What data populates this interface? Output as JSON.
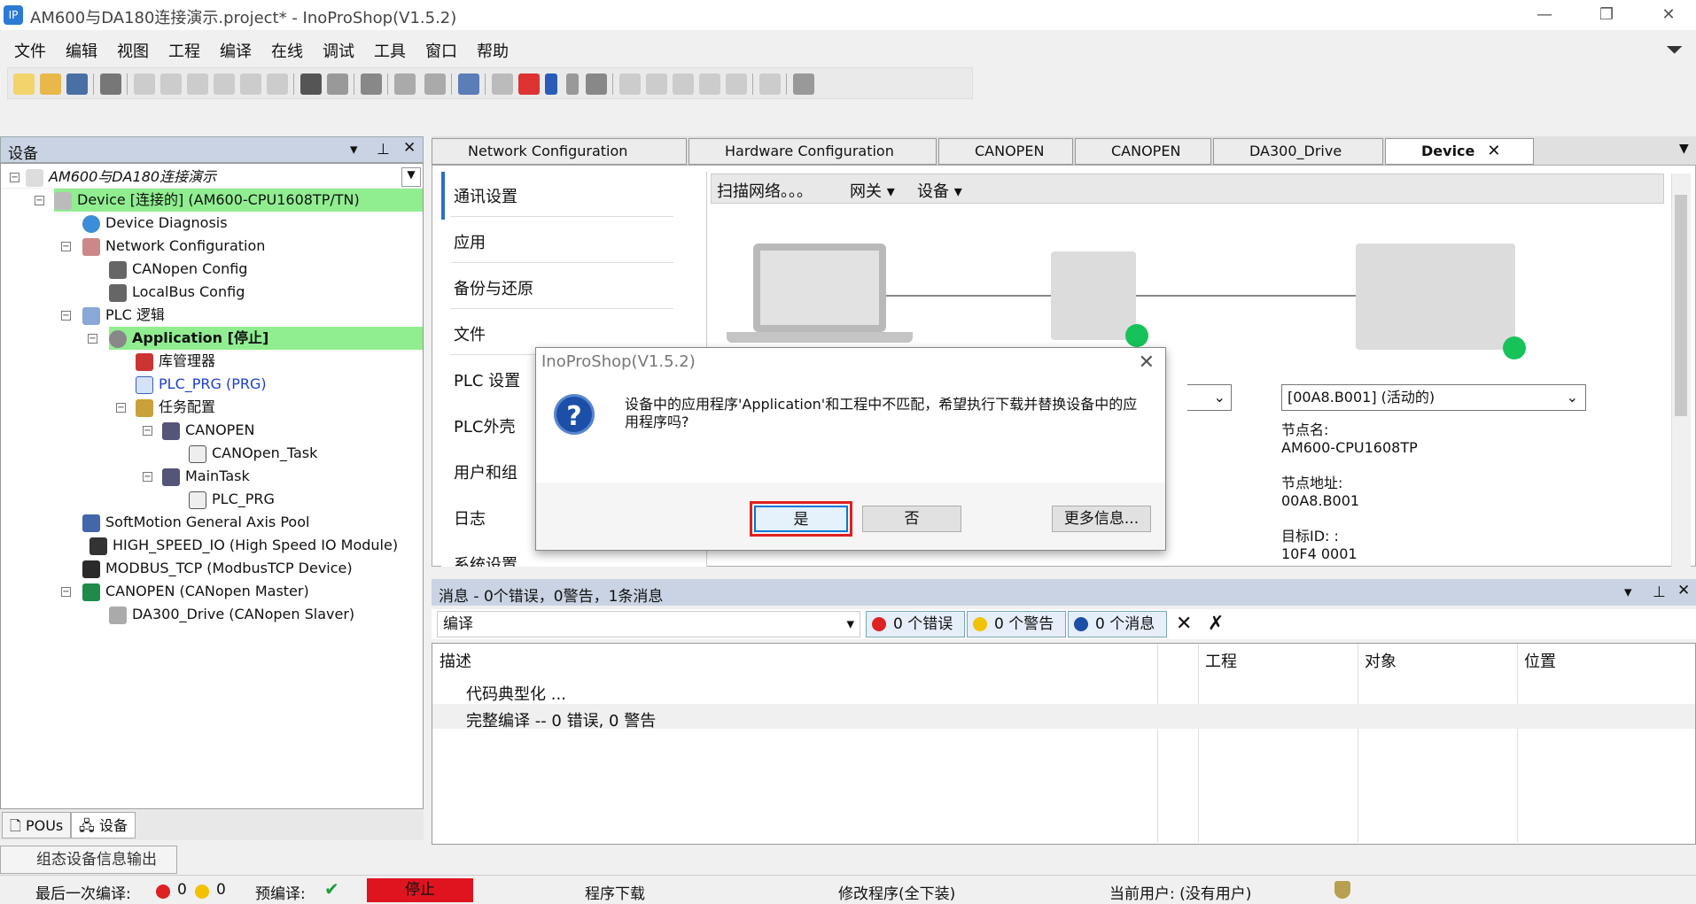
{
  "window": {
    "title": "AM600与DA180连接演示.project* - InoProShop(V1.5.2)",
    "min": "—",
    "max": "❐",
    "close": "✕"
  },
  "menu": [
    "文件",
    "编辑",
    "视图",
    "工程",
    "编译",
    "在线",
    "调试",
    "工具",
    "窗口",
    "帮助"
  ],
  "device_panel": {
    "title": "设备",
    "tree": [
      "AM600与DA180连接演示",
      "Device [连接的] (AM600-CPU1608TP/TN)",
      "Device Diagnosis",
      "Network Configuration",
      "CANopen Config",
      "LocalBus Config",
      "PLC 逻辑",
      "Application [停止]",
      "库管理器",
      "PLC_PRG (PRG)",
      "任务配置",
      "CANOPEN",
      "CANOpen_Task",
      "MainTask",
      "PLC_PRG",
      "SoftMotion General Axis Pool",
      "HIGH_SPEED_IO (High Speed IO Module)",
      "MODBUS_TCP (ModbusTCP Device)",
      "CANOPEN (CANopen Master)",
      "DA300_Drive (CANopen Slaver)"
    ],
    "tabs": [
      "POUs",
      "设备"
    ],
    "output_tab": "组态设备信息输出"
  },
  "editor_tabs": [
    "Network Configuration",
    "Hardware Configuration",
    "CANOPEN",
    "CANOPEN",
    "DA300_Drive",
    "Device"
  ],
  "side_menu": [
    "通讯设置",
    "应用",
    "备份与还原",
    "文件",
    "PLC 设置",
    "PLC外壳",
    "用户和组",
    "日志",
    "系统设置"
  ],
  "net_toolbar": {
    "scan": "扫描网络。。。",
    "gateway": "网关",
    "device": "设备"
  },
  "device_info": {
    "dropdown": "[00A8.B001] (活动的)",
    "node_name_label": "节点名:",
    "node_name": "AM600-CPU1608TP",
    "node_addr_label": "节点地址:",
    "node_addr": "00A8.B001",
    "target_id_label": "目标ID: :",
    "target_id": "10F4 0001"
  },
  "dialog": {
    "title": "InoProShop(V1.5.2)",
    "message": "设备中的应用程序'Application'和工程中不匹配，希望执行下载并替换设备中的应用程序吗?",
    "yes": "是",
    "no": "否",
    "more": "更多信息..."
  },
  "messages": {
    "title": "消息 - 0个错误，0警告，1条消息",
    "source": "编译",
    "errors": "0 个错误",
    "warnings": "0 个警告",
    "infos": "0 个消息",
    "columns": [
      "描述",
      "工程",
      "对象",
      "位置"
    ],
    "rows": [
      "代码典型化 ...",
      "完整编译 -- 0 错误, 0 警告"
    ]
  },
  "status": {
    "last_compile_label": "最后一次编译:",
    "err_count": "0",
    "warn_count": "0",
    "precompile_label": "预编译:",
    "state": "停止",
    "download": "程序下载",
    "modify": "修改程序(全下装)",
    "user": "当前用户: (没有用户)"
  },
  "colors": {
    "highlight": "#90ee90",
    "stop": "#e0141e",
    "panel_head": "#c9d3e3"
  }
}
